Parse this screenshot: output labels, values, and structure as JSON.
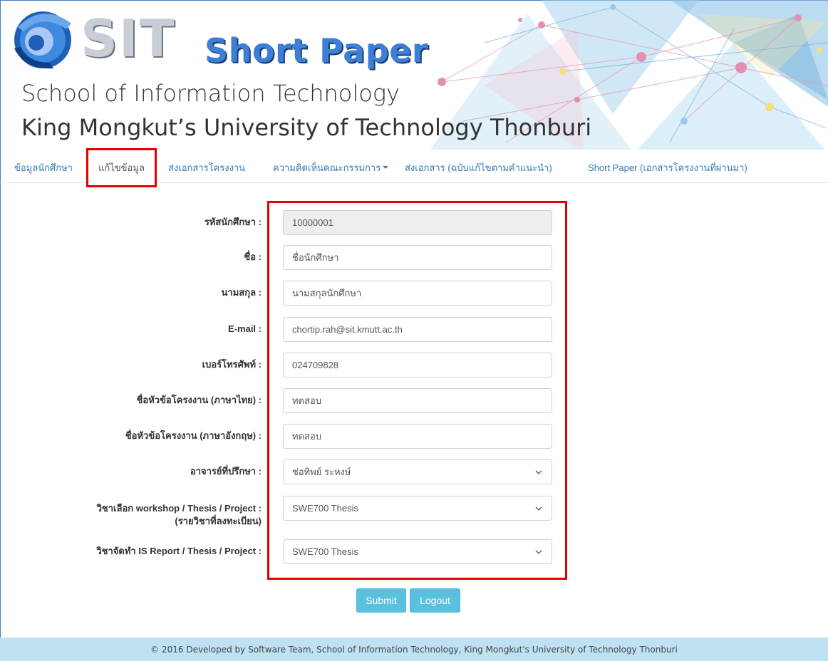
{
  "header": {
    "logo_text": "SIT",
    "app_title": "Short Paper",
    "school_line1": "School of Information Technology",
    "school_line2": "King Mongkut’s University of Technology Thonburi"
  },
  "nav": {
    "items": [
      {
        "label": "ข้อมูลนักศึกษา"
      },
      {
        "label": "แก้ไขข้อมูล"
      },
      {
        "label": "ส่งเอกสารโครงงาน"
      },
      {
        "label": "ความคิดเห็นคณะกรรมการ"
      },
      {
        "label": "ส่งเอกสาร (ฉบับแก้ไขตามคำแนะนำ)"
      },
      {
        "label": "Short Paper (เอกสารโครงงานที่ผ่านมา)"
      }
    ]
  },
  "form": {
    "student_id": {
      "label": "รหัสนักศึกษา :",
      "value": "10000001"
    },
    "first_name": {
      "label": "ชื่อ :",
      "value": "ชื่อนักศึกษา"
    },
    "last_name": {
      "label": "นามสกุล :",
      "value": "นามสกุลนักศึกษา"
    },
    "email": {
      "label": "E-mail :",
      "value": "chortip.rah@sit.kmutt.ac.th"
    },
    "phone": {
      "label": "เบอร์โทรศัพท์ :",
      "value": "024709828"
    },
    "title_th": {
      "label": "ชื่อหัวข้อโครงงาน (ภาษาไทย) :",
      "value": "ทดสอบ"
    },
    "title_en": {
      "label": "ชื่อหัวข้อโครงงาน (ภาษาอังกฤษ) :",
      "value": "ทดสอบ"
    },
    "advisor": {
      "label": "อาจารย์ที่ปรึกษา :",
      "value": "ช่อทิพย์ ระหงษ์"
    },
    "course_enrolled": {
      "label_line1": "วิชาเลือก workshop / Thesis / Project :",
      "label_line2": "(รายวิชาที่ลงทะเบียน)",
      "value": "SWE700 Thesis"
    },
    "course_report": {
      "label": "วิชาจัดทำ IS Report / Thesis / Project :",
      "value": "SWE700 Thesis"
    }
  },
  "buttons": {
    "submit": "Submit",
    "logout": "Logout"
  },
  "footer": {
    "text": "© 2016 Developed by Software Team, School of Information Technology, King Mongkut's University of Technology Thonburi"
  },
  "colors": {
    "accent": "#337ab7",
    "button": "#5bc0de",
    "highlight_border": "#e20000",
    "footer_bg": "#bfe2f3"
  }
}
